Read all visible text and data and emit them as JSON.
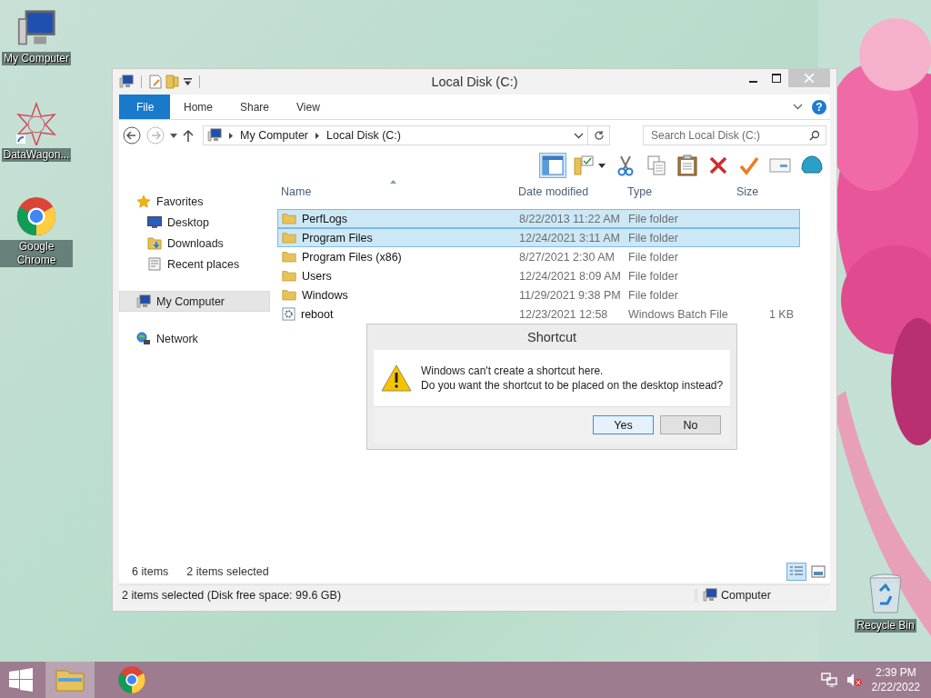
{
  "desktop_icons": [
    {
      "label": "My Computer",
      "kind": "computer"
    },
    {
      "label": "DataWagon...",
      "kind": "star"
    },
    {
      "label": "Google Chrome",
      "kind": "chrome"
    },
    {
      "label": "Recycle Bin",
      "kind": "recycle"
    }
  ],
  "window": {
    "title": "Local Disk (C:)",
    "ribbon_tabs": [
      {
        "label": "File",
        "kind": "menu"
      },
      {
        "label": "Home",
        "kind": "tab"
      },
      {
        "label": "Share",
        "kind": "tab"
      },
      {
        "label": "View",
        "kind": "tab"
      }
    ],
    "help": "?",
    "address": {
      "crumbs": [
        "My Computer",
        "Local Disk (C:)"
      ],
      "search_placeholder": "Search Local Disk (C:)"
    },
    "toolbar": [
      {
        "kind": "pane",
        "selected": true
      },
      {
        "kind": "folder",
        "selected": false
      },
      {
        "kind": "cut",
        "selected": false
      },
      {
        "kind": "copy",
        "selected": false
      },
      {
        "kind": "paste",
        "selected": false
      },
      {
        "kind": "delete",
        "selected": false
      },
      {
        "kind": "check",
        "selected": false
      },
      {
        "kind": "rename",
        "selected": false
      },
      {
        "kind": "shell",
        "selected": false
      }
    ],
    "nav": [
      {
        "label": "Favorites",
        "kind": "favorites",
        "selected": false,
        "children": [
          {
            "label": "Desktop",
            "kind": "desktop",
            "selected": false
          },
          {
            "label": "Downloads",
            "kind": "downloads",
            "selected": false
          },
          {
            "label": "Recent places",
            "kind": "recent",
            "selected": false
          }
        ]
      },
      {
        "label": "My Computer",
        "kind": "computer",
        "selected": true
      },
      {
        "label": "Network",
        "kind": "network",
        "selected": false
      }
    ],
    "columns": [
      "Name",
      "Date modified",
      "Type",
      "Size"
    ],
    "rows": [
      {
        "name": "PerfLogs",
        "date": "8/22/2013 11:22 AM",
        "type": "File folder",
        "kind": "folder",
        "selected": true
      },
      {
        "name": "Program Files",
        "date": "12/24/2021 3:11 AM",
        "type": "File folder",
        "kind": "folder",
        "selected": true
      },
      {
        "name": "Program Files (x86)",
        "date": "8/27/2021 2:30 AM",
        "type": "File folder",
        "kind": "folder",
        "selected": false
      },
      {
        "name": "Users",
        "date": "12/24/2021 8:09 AM",
        "type": "File folder",
        "kind": "folder",
        "selected": false
      },
      {
        "name": "Windows",
        "date": "11/29/2021 9:38 PM",
        "type": "File folder",
        "kind": "folder",
        "selected": false
      },
      {
        "name": "reboot",
        "date": "12/23/2021 12:58",
        "type": "Windows Batch File",
        "size": "1 KB",
        "kind": "batch",
        "selected": false
      }
    ],
    "item_count": "6 items",
    "selected_count": "2 items selected",
    "views": [
      {
        "kind": "details",
        "selected": true
      },
      {
        "kind": "tiles",
        "selected": false
      }
    ],
    "status_bar": {
      "text": "2 items selected (Disk free space: 99.6 GB)",
      "location": "Computer"
    }
  },
  "dialog": {
    "title": "Shortcut",
    "message": [
      "Windows can't create a shortcut here.",
      "Do you want the shortcut to be placed on the desktop instead?"
    ],
    "buttons": [
      {
        "label": "Yes",
        "default": true
      },
      {
        "label": "No",
        "default": false
      }
    ]
  },
  "taskbar": {
    "apps": [
      {
        "kind": "explorer",
        "selected": true
      },
      {
        "kind": "chrome",
        "selected": false
      }
    ],
    "time": "2:39 PM",
    "date": "2/22/2022"
  }
}
